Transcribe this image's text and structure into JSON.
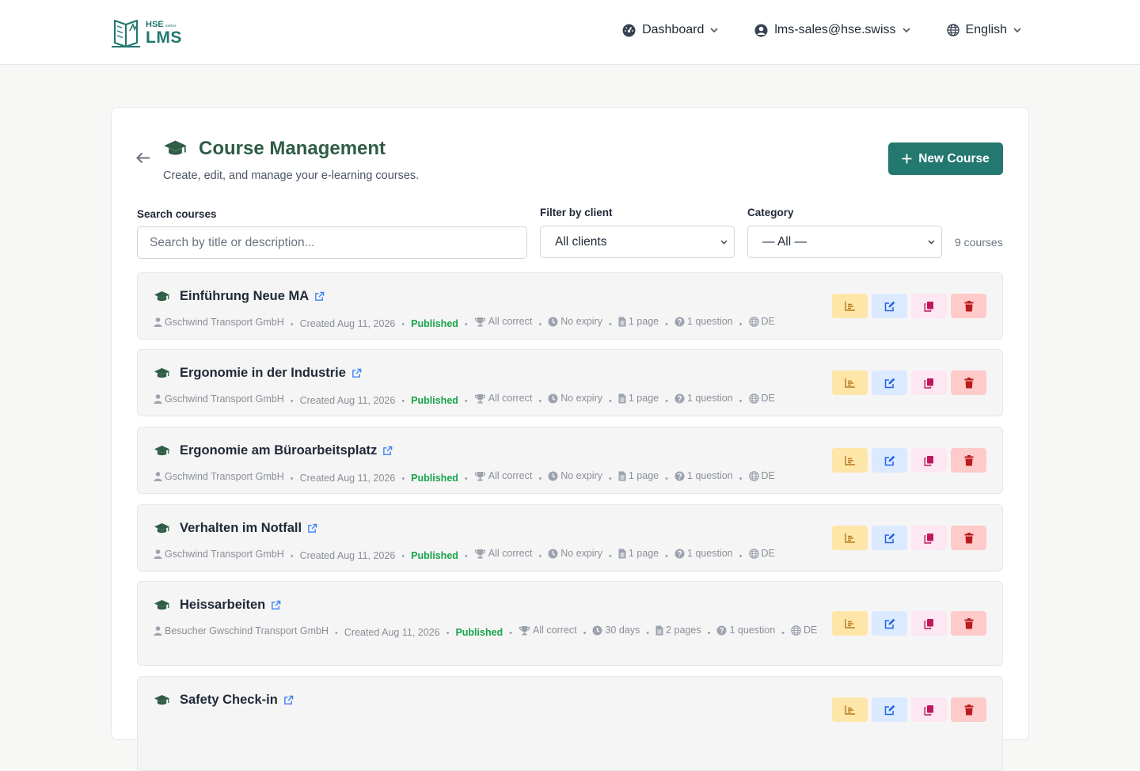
{
  "header": {
    "logo": {
      "top": "HSE",
      "top_small": ".swiss",
      "main": "LMS"
    },
    "nav": {
      "dashboard": "Dashboard",
      "account": "lms-sales@hse.swiss",
      "language": "English"
    }
  },
  "page": {
    "title": "Course Management",
    "subtitle": "Create, edit, and manage your e-learning courses.",
    "new_course_label": "New Course"
  },
  "filters": {
    "search_label": "Search courses",
    "search_placeholder": "Search by title or description...",
    "client_label": "Filter by client",
    "client_value": "All clients",
    "category_label": "Category",
    "category_value": "— All —",
    "count_text": "9 courses"
  },
  "courses": [
    {
      "title": "Einführung Neue MA",
      "client": "Gschwind Transport GmbH",
      "created": "Created Aug 11, 2026",
      "status": "Published",
      "passing": "All correct",
      "expiry": "No expiry",
      "pages": "1 page",
      "questions": "1 question",
      "lang": "DE"
    },
    {
      "title": "Ergonomie in der Industrie",
      "client": "Gschwind Transport GmbH",
      "created": "Created Aug 11, 2026",
      "status": "Published",
      "passing": "All correct",
      "expiry": "No expiry",
      "pages": "1 page",
      "questions": "1 question",
      "lang": "DE"
    },
    {
      "title": "Ergonomie am Büroarbeitsplatz",
      "client": "Gschwind Transport GmbH",
      "created": "Created Aug 11, 2026",
      "status": "Published",
      "passing": "All correct",
      "expiry": "No expiry",
      "pages": "1 page",
      "questions": "1 question",
      "lang": "DE"
    },
    {
      "title": "Verhalten im Notfall",
      "client": "Gschwind Transport GmbH",
      "created": "Created Aug 11, 2026",
      "status": "Published",
      "passing": "All correct",
      "expiry": "No expiry",
      "pages": "1 page",
      "questions": "1 question",
      "lang": "DE"
    },
    {
      "title": "Heissarbeiten",
      "client": "Besucher Gwschind Transport GmbH",
      "created": "Created Aug 11, 2026",
      "status": "Published",
      "passing": "All correct",
      "expiry": "30 days",
      "pages": "2 pages",
      "questions": "1 question",
      "lang": "DE"
    },
    {
      "title": "Safety Check-in"
    }
  ],
  "colors": {
    "brand": "#23786f",
    "title_green": "#2f5d45",
    "published_green": "#16a34a",
    "stats_bg": "#fde6a8",
    "edit_bg": "#dbeafe",
    "copy_bg": "#fce7f3",
    "delete_bg": "#fecaca"
  },
  "icons": {
    "course": "graduation-cap-icon",
    "open": "external-link-icon",
    "client": "user-icon",
    "passing": "trophy-icon",
    "expiry": "clock-icon",
    "pages": "file-icon",
    "questions": "question-circle-icon",
    "language": "globe-icon",
    "stats": "bar-chart-icon",
    "edit": "edit-icon",
    "copy": "copy-icon",
    "delete": "trash-icon"
  }
}
